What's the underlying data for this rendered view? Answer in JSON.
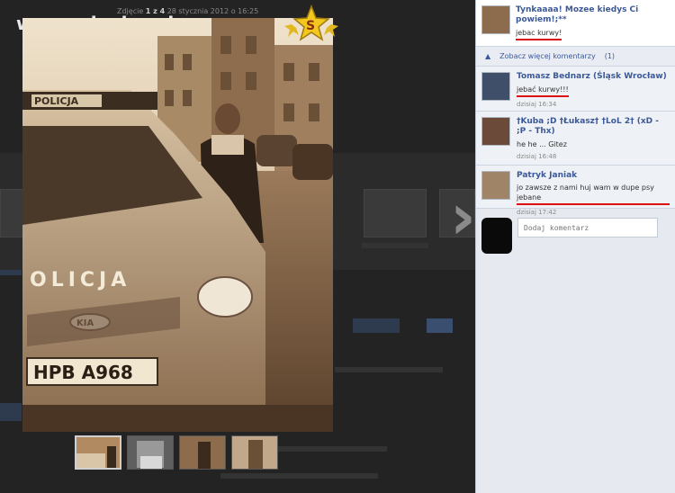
{
  "watermark": {
    "text": "www.wiocha.pl"
  },
  "photo": {
    "caption_prefix": "Zdjęcie",
    "caption_index": "1 z 4",
    "caption_date": "28 stycznia 2012 o 16:25",
    "car_sign": "POLICJA",
    "car_text": "OLICJA",
    "plate": "HPB A968",
    "badge_letter": "S"
  },
  "thumbnails": [
    "thumb-1",
    "thumb-2",
    "thumb-3",
    "thumb-4"
  ],
  "panel": {
    "post": {
      "text": "Tynkaaaa! Mozee kiedys Ci powiem!;**",
      "comment": "jebac kurwy!"
    },
    "more_comments": {
      "label": "Zobacz więcej komentarzy",
      "count": "(1)"
    },
    "comments": [
      {
        "name": "Tomasz Bednarz (Śląsk Wrocław)",
        "text": "jebać kurwy!!!",
        "time": "dzisiaj 16:34",
        "underline": true
      },
      {
        "name": "†Kuba ;D †Łukasz† †LoL 2† (xD - ;P - Thx)",
        "text": "he he ... Gitez",
        "time": "dzisiaj 16:48",
        "underline": false
      },
      {
        "name": "Patryk Janiak",
        "text": "jo zawsze z nami huj wam w dupe psy jebane",
        "time": "dzisiaj 17:42",
        "underline": true
      }
    ],
    "add_comment": {
      "placeholder": "Dodaj komentarz"
    }
  },
  "colors": {
    "link": "#3b5998",
    "underline": "#dd1111",
    "panel_bg": "#e6eaf0"
  }
}
